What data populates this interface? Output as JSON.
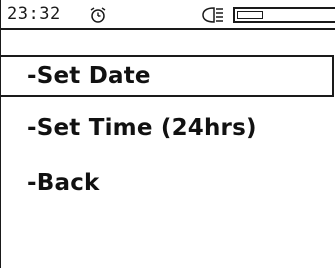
{
  "status_bar": {
    "time": "23:32",
    "icons": [
      "alarm-clock-icon",
      "headlight-icon",
      "battery-icon"
    ],
    "battery_level_fraction": 0.25
  },
  "menu": {
    "items": [
      {
        "label": "-Set Date",
        "selected": true
      },
      {
        "label": "-Set Time (24hrs)",
        "selected": false
      },
      {
        "label": "-Back",
        "selected": false
      }
    ]
  },
  "colors": {
    "foreground": "#1a1a1a",
    "background": "#ffffff"
  }
}
